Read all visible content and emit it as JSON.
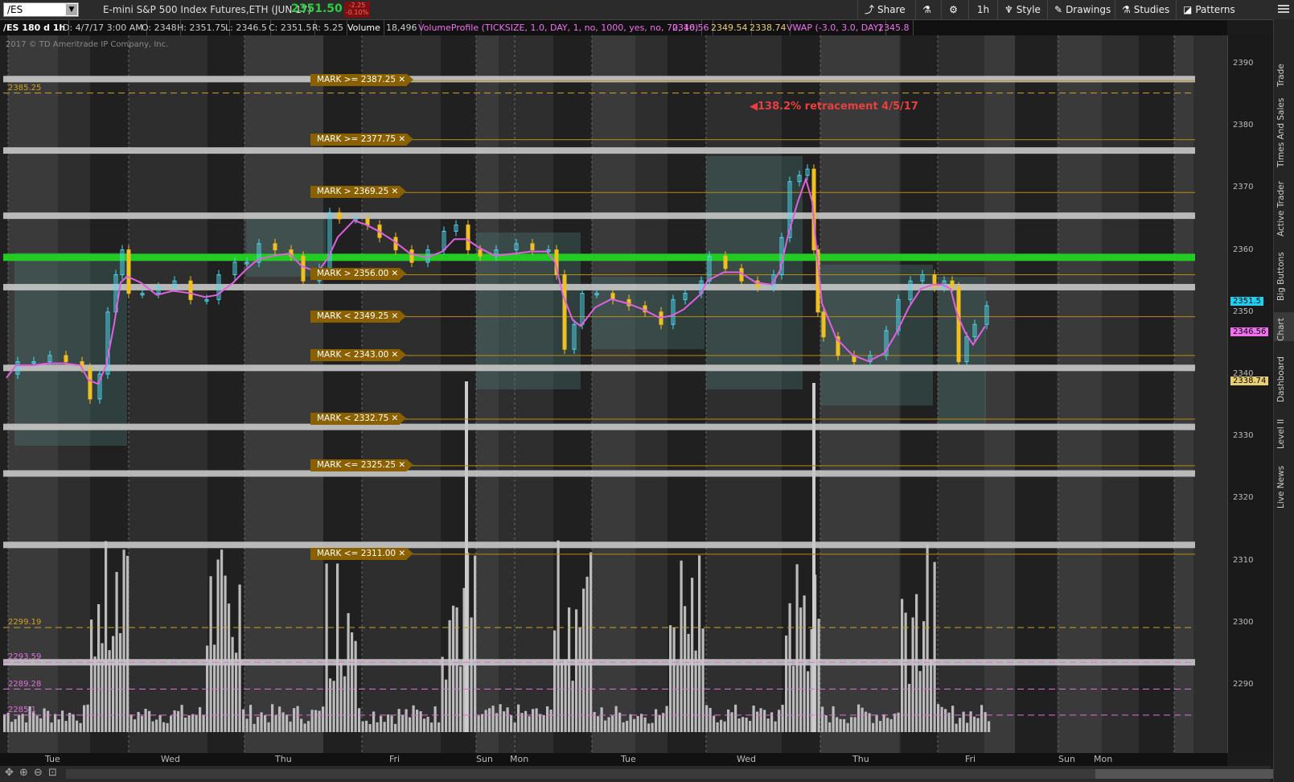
{
  "header": {
    "symbol": "/ES",
    "description": "E-mini S&P 500 Index Futures,ETH (JUN 17)",
    "last_price": "2351.50",
    "change_abs": "-2.25",
    "change_pct": "-0.10%",
    "buttons": {
      "share": "Share",
      "interval": "1h",
      "style": "Style",
      "drawings": "Drawings",
      "studies": "Studies",
      "patterns": "Patterns"
    }
  },
  "infobar": {
    "chart_id": "/ES 180 d 1h",
    "date": "D: 4/7/17 3:00 AM",
    "open": "O: 2348",
    "high": "H: 2351.75",
    "low": "L: 2346.5",
    "close": "C: 2351.5",
    "range": "R: 5.25",
    "volume_label": "Volume",
    "volume_value": "18,496",
    "volume_profile": "VolumeProfile (TICKSIZE, 1.0, DAY, 1, no, 1000, yes, no, 70, 10)",
    "vp1": "2346.56",
    "vp2": "2349.54",
    "vp3": "2338.74",
    "vwap": "VWAP (-3.0, 3.0, DAY)",
    "vwap_value": "2345.8"
  },
  "copyright": "2017 © TD Ameritrade IP Company, Inc.",
  "annotation": "138.2% retracement 4/5/17",
  "marks": [
    {
      "label": "MARK >= 2387.25",
      "price": 2387.25
    },
    {
      "label": "MARK >= 2377.75",
      "price": 2377.75
    },
    {
      "label": "MARK > 2369.25",
      "price": 2369.25
    },
    {
      "label": "MARK > 2356.00",
      "price": 2356.0
    },
    {
      "label": "MARK < 2349.25",
      "price": 2349.25
    },
    {
      "label": "MARK < 2343.00",
      "price": 2343.0
    },
    {
      "label": "MARK < 2332.75",
      "price": 2332.75
    },
    {
      "label": "MARK <= 2325.25",
      "price": 2325.25
    },
    {
      "label": "MARK <= 2311.00",
      "price": 2311.0
    }
  ],
  "dashed_levels": [
    {
      "label": "2385.25",
      "price": 2385.25,
      "color": "#d4a020"
    },
    {
      "label": "2299.19",
      "price": 2299.19,
      "color": "#d4a020"
    },
    {
      "label": "2293.59",
      "price": 2293.59,
      "color": "#e070e0"
    },
    {
      "label": "2289.28",
      "price": 2289.28,
      "color": "#e070e0"
    },
    {
      "label": "2285.1",
      "price": 2285.1,
      "color": "#e070e0"
    }
  ],
  "white_levels": [
    2387.5,
    2376.0,
    2365.5,
    2354.0,
    2341.0,
    2331.5,
    2324.0,
    2312.5,
    2293.6
  ],
  "green_level": 2358.8,
  "price_tags": [
    {
      "label": "2351.5",
      "price": 2351.5,
      "color": "#20d0f0"
    },
    {
      "label": "2346.56",
      "price": 2346.56,
      "color": "#f070f0"
    },
    {
      "label": "2338.74",
      "price": 2338.74,
      "color": "#e8d070"
    }
  ],
  "yaxis": {
    "ticks": [
      "2390",
      "2380",
      "2370",
      "2360",
      "2350",
      "2340",
      "2330",
      "2320",
      "2310",
      "2300",
      "2290"
    ]
  },
  "xaxis": {
    "labels": [
      "Tue",
      "Wed",
      "Thu",
      "Fri",
      "Sun",
      "Mon",
      "Tue",
      "Wed",
      "Thu",
      "Fri",
      "Sun",
      "Mon"
    ]
  },
  "right_tabs": [
    "Trade",
    "Times And Sales",
    "Active Trader",
    "Big Buttons",
    "Chart",
    "Dashboard",
    "Level II",
    "Live News"
  ],
  "colors": {
    "up": "#4fd8f0",
    "down": "#f0c020",
    "vwap": "#e060e0",
    "green_band": "#22cc22"
  }
}
